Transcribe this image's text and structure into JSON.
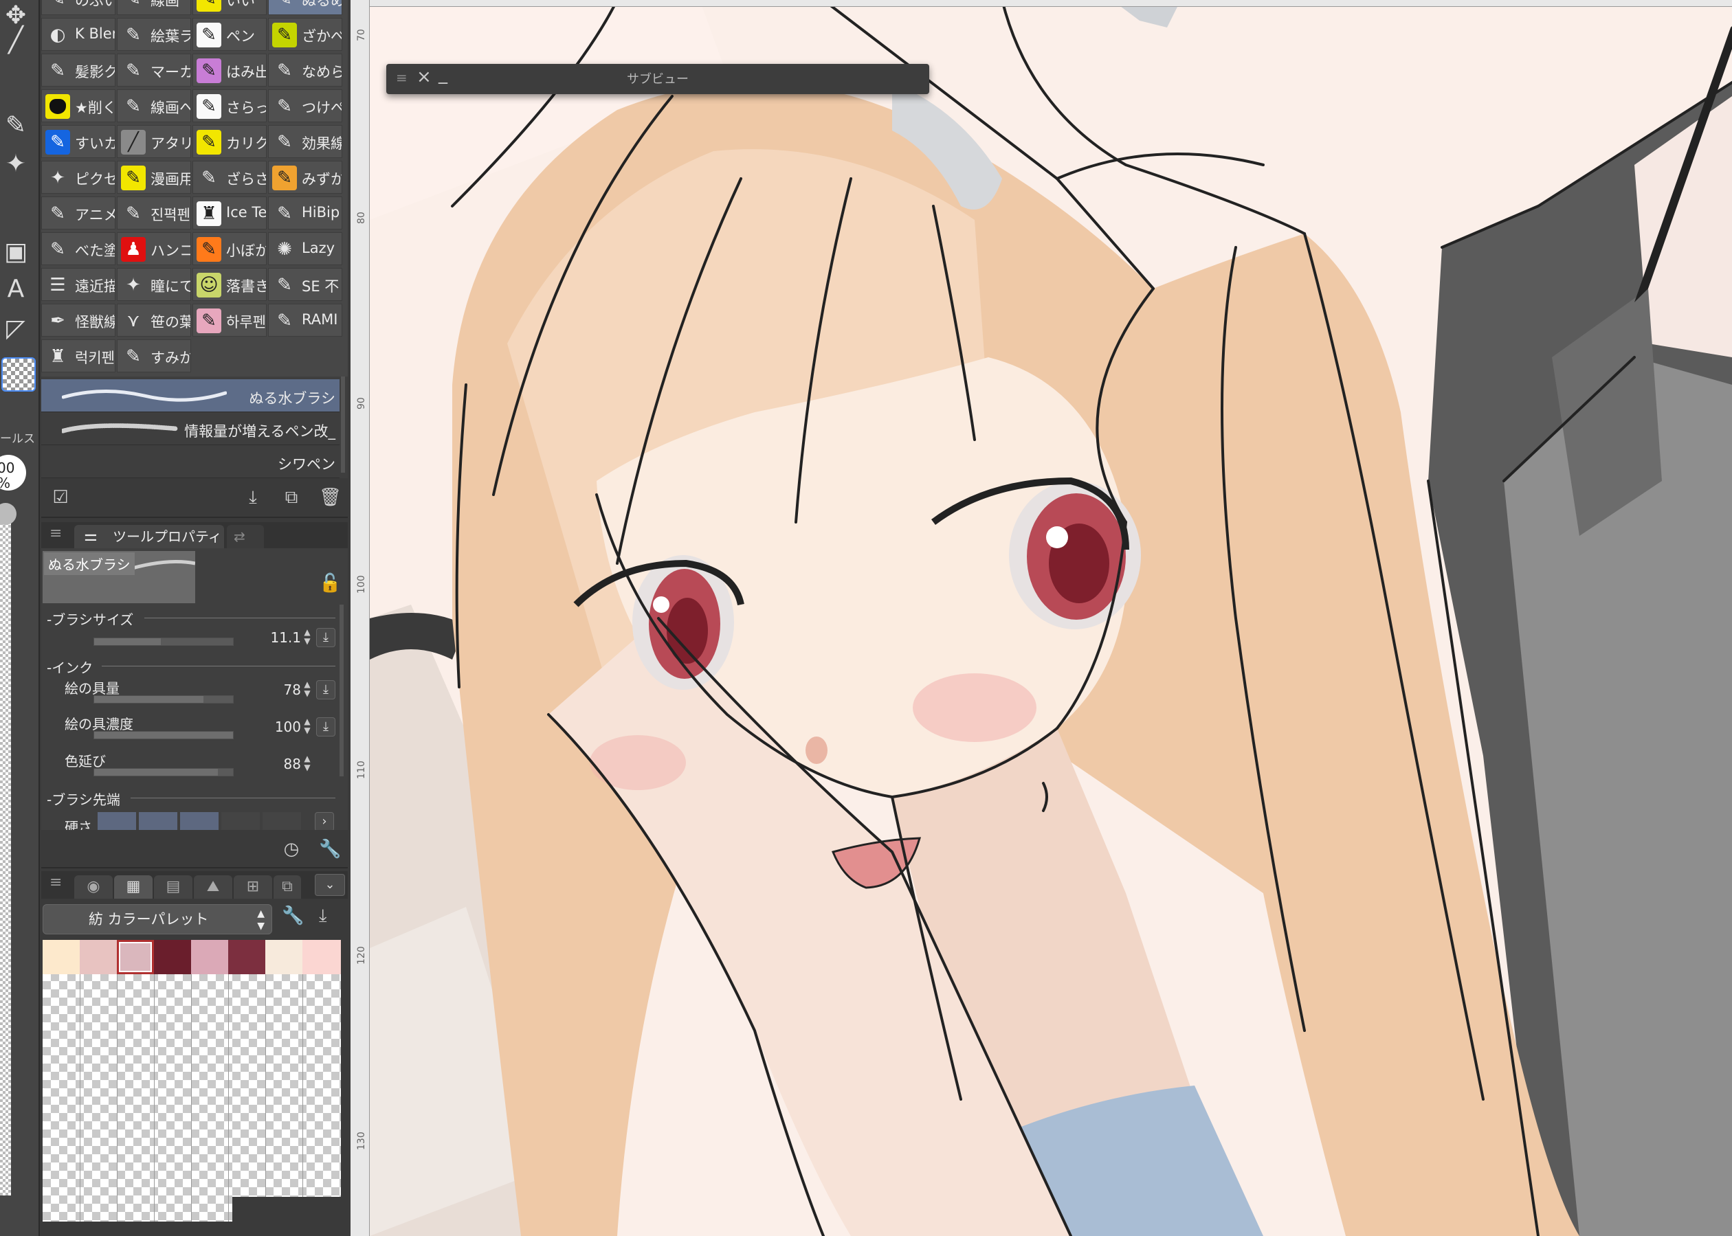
{
  "tools": {
    "panel_label": "ールス",
    "opacity_value": "00\n%"
  },
  "brush_grid": [
    [
      "K Blen",
      "絵葉ラ",
      "ペン",
      "ざかべ"
    ],
    [
      "髪影ク",
      "マーカ",
      "はみ出",
      "なめら"
    ],
    [
      "★削く",
      "線画へ",
      "さらっ",
      "つけぺ"
    ],
    [
      "すいカ",
      "アタリ",
      "カリク",
      "効果線"
    ],
    [
      "ピクセ",
      "漫画用",
      "ざらさ",
      "みずか"
    ],
    [
      "アニメ",
      "진펵펜",
      "Ice Te",
      "HiBip"
    ],
    [
      "べた塗",
      "ハンコ",
      "小ぼか",
      "Lazy"
    ],
    [
      "遠近描",
      "瞳にて",
      "落書き",
      "SE 不"
    ],
    [
      "怪獣線",
      "笹の葉",
      "하루펜",
      "RAMI"
    ],
    [
      "럭키펜",
      "すみか",
      "",
      ""
    ]
  ],
  "brush_top_row": [
    "のぶい",
    "線画",
    "いい",
    "ぬるめ"
  ],
  "brush_list": [
    "ぬる水ブラシ",
    "情報量が増えるペン改_",
    "シワペン"
  ],
  "tool_property": {
    "tab_label": "ツールプロパティ",
    "preview_label": "ぬる水ブラシ",
    "brush_size_label": "ブラシサイズ",
    "brush_size_value": "11.1",
    "ink_label": "インク",
    "paint_amount_label": "絵の具量",
    "paint_amount_value": "78",
    "paint_density_label": "絵の具濃度",
    "paint_density_value": "100",
    "color_stretch_label": "色延び",
    "color_stretch_value": "88",
    "brush_tip_label": "ブラシ先端",
    "hardness_label": "硬さ"
  },
  "color_palette": {
    "set_name": "紡 カラーパレット",
    "swatches": [
      "#fde9cc",
      "#e8c3c1",
      "#dab7bd",
      "#6a1e2c",
      "#dba9b7",
      "#7c2f3f",
      "#f7eadc",
      "#fbd6d2"
    ]
  },
  "canvas": {
    "subview_title": "サブビュー",
    "ruler_ticks": [
      "70",
      "80",
      "90",
      "100",
      "110",
      "120",
      "130"
    ]
  }
}
